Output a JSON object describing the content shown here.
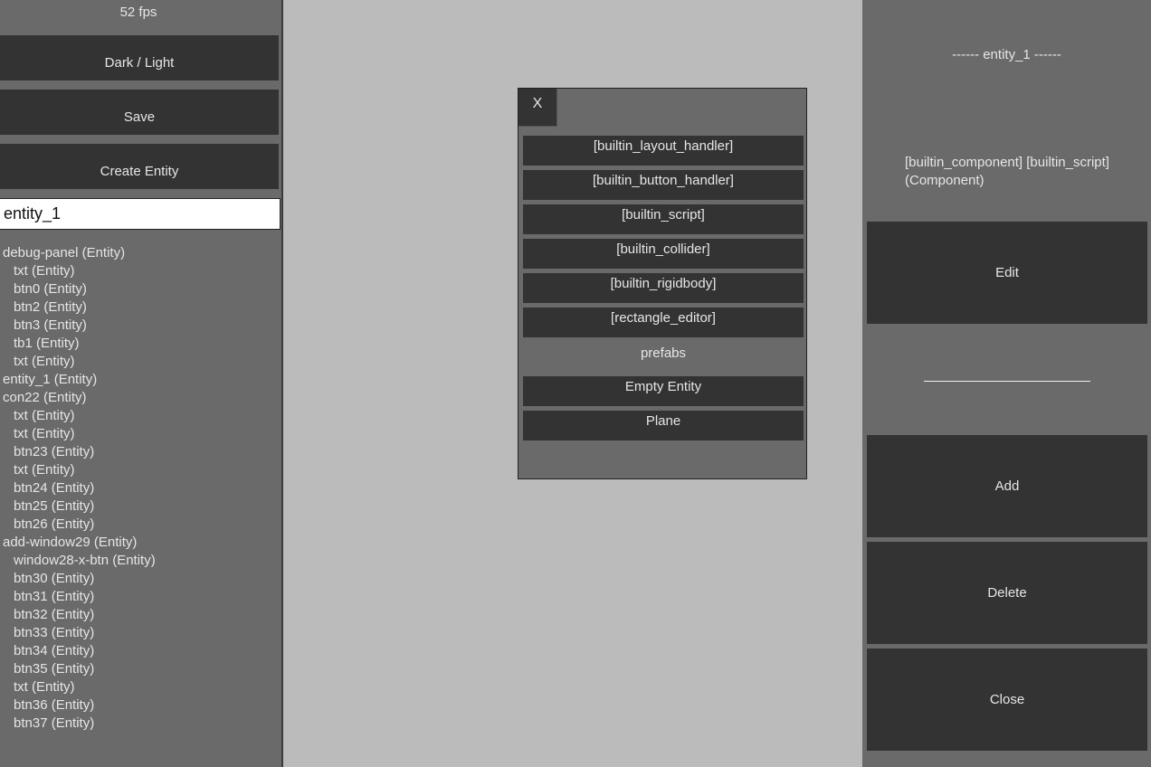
{
  "left_panel": {
    "fps": "52 fps",
    "buttons": {
      "theme": "Dark / Light",
      "save": "Save",
      "create_entity": "Create Entity"
    },
    "name_input": {
      "value": "entity_1"
    },
    "tree": [
      {
        "label": "debug-panel (Entity)",
        "depth": 0
      },
      {
        "label": "txt (Entity)",
        "depth": 1
      },
      {
        "label": "btn0 (Entity)",
        "depth": 1
      },
      {
        "label": "btn2 (Entity)",
        "depth": 1
      },
      {
        "label": "btn3 (Entity)",
        "depth": 1
      },
      {
        "label": "tb1 (Entity)",
        "depth": 1
      },
      {
        "label": "txt (Entity)",
        "depth": 1
      },
      {
        "label": "entity_1 (Entity)",
        "depth": 0
      },
      {
        "label": "con22 (Entity)",
        "depth": 0
      },
      {
        "label": "txt (Entity)",
        "depth": 1
      },
      {
        "label": "txt (Entity)",
        "depth": 1
      },
      {
        "label": "btn23 (Entity)",
        "depth": 1
      },
      {
        "label": "txt (Entity)",
        "depth": 1
      },
      {
        "label": "btn24 (Entity)",
        "depth": 1
      },
      {
        "label": "btn25 (Entity)",
        "depth": 1
      },
      {
        "label": "btn26 (Entity)",
        "depth": 1
      },
      {
        "label": "add-window29 (Entity)",
        "depth": 0
      },
      {
        "label": "window28-x-btn (Entity)",
        "depth": 1
      },
      {
        "label": "btn30 (Entity)",
        "depth": 1
      },
      {
        "label": "btn31 (Entity)",
        "depth": 1
      },
      {
        "label": "btn32 (Entity)",
        "depth": 1
      },
      {
        "label": "btn33 (Entity)",
        "depth": 1
      },
      {
        "label": "btn34 (Entity)",
        "depth": 1
      },
      {
        "label": "btn35 (Entity)",
        "depth": 1
      },
      {
        "label": "txt (Entity)",
        "depth": 1
      },
      {
        "label": "btn36 (Entity)",
        "depth": 1
      },
      {
        "label": "btn37 (Entity)",
        "depth": 1
      }
    ]
  },
  "add_window": {
    "close_label": "X",
    "components": [
      "[builtin_layout_handler]",
      "[builtin_button_handler]",
      "[builtin_script]",
      "[builtin_collider]",
      "[builtin_rigidbody]",
      "[rectangle_editor]"
    ],
    "prefabs_label": "prefabs",
    "prefabs": [
      "Empty Entity",
      "Plane"
    ]
  },
  "right_panel": {
    "entity_title": "------ entity_1 ------",
    "components_text": "[builtin_component] [builtin_script] (Component)",
    "edit_label": "Edit",
    "add_label": "Add",
    "delete_label": "Delete",
    "close_label": "Close"
  }
}
